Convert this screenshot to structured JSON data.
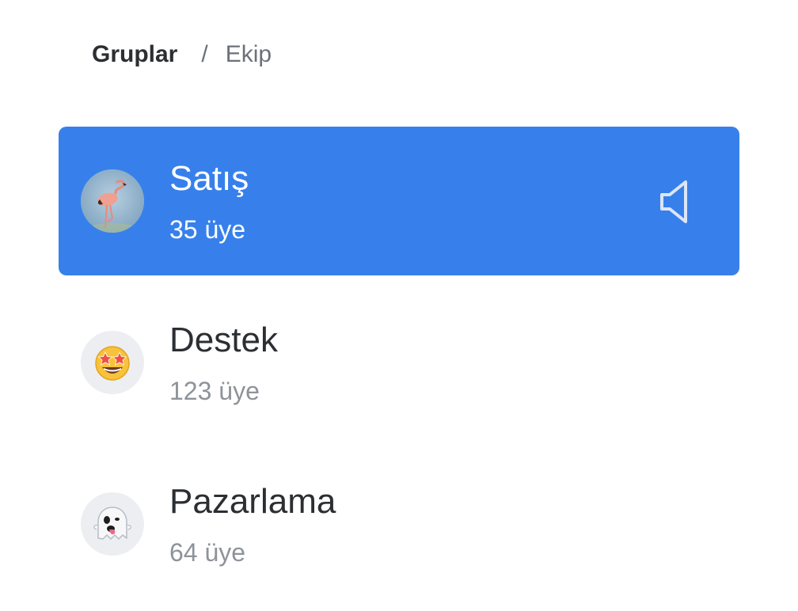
{
  "breadcrumb": {
    "root": "Gruplar",
    "separator": "/",
    "current": "Ekip"
  },
  "groups": [
    {
      "name": "Satış",
      "member_count": "35 üye",
      "avatar_icon": "flamingo-icon",
      "active": true,
      "status_icon": "muted-speaker-icon"
    },
    {
      "name": "Destek",
      "member_count": "123 üye",
      "avatar_icon": "star-struck-emoji-icon",
      "active": false
    },
    {
      "name": "Pazarlama",
      "member_count": "64 üye",
      "avatar_icon": "ghost-emoji-icon",
      "active": false
    }
  ],
  "colors": {
    "accent": "#3780eb",
    "text_primary": "#2b2f33",
    "text_secondary": "#8e939a",
    "avatar_bg": "#eceef1"
  }
}
